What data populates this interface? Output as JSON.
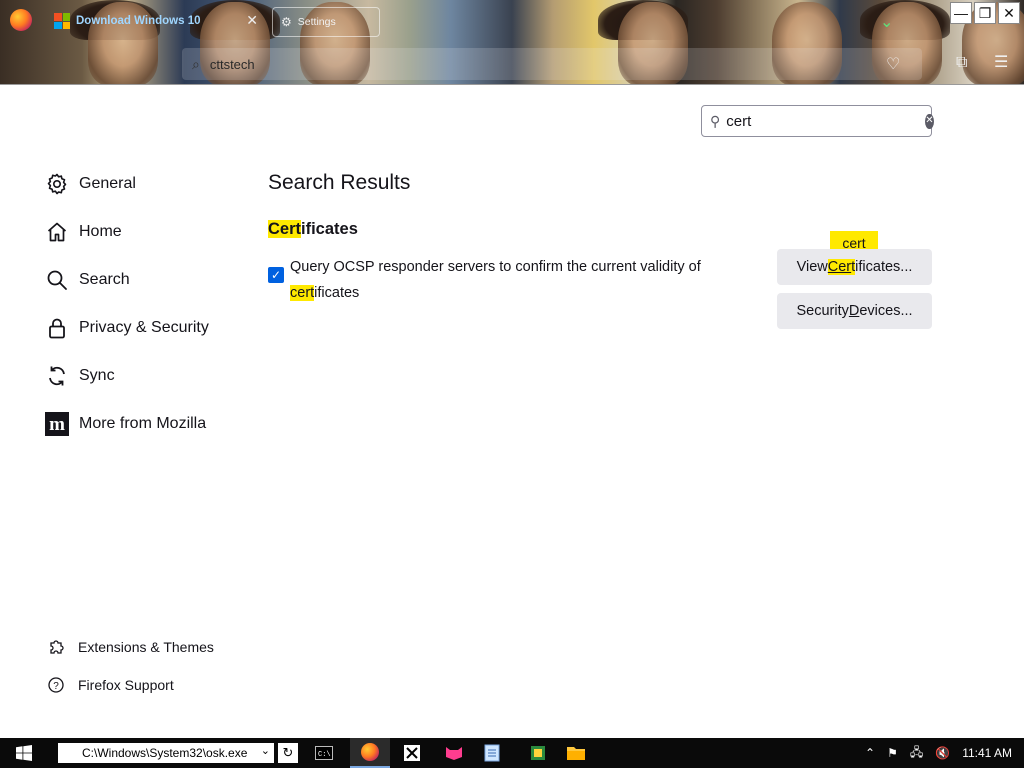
{
  "browser": {
    "tab_title": "Download Windows 10",
    "tab2_label": "Settings",
    "url_text": "cttstech",
    "window_controls": [
      "minimize-icon",
      "restore-icon",
      "close-icon"
    ]
  },
  "search": {
    "value": "cert",
    "clear_icon": "clear-icon"
  },
  "nav": {
    "items": [
      {
        "label": "General",
        "icon": "gear-icon"
      },
      {
        "label": "Home",
        "icon": "home-icon"
      },
      {
        "label": "Search",
        "icon": "search-icon"
      },
      {
        "label": "Privacy & Security",
        "icon": "lock-icon"
      },
      {
        "label": "Sync",
        "icon": "sync-icon"
      },
      {
        "label": "More from Mozilla",
        "icon": "mozilla-icon"
      }
    ],
    "bottom": [
      {
        "label": "Extensions & Themes",
        "icon": "puzzle-icon"
      },
      {
        "label": "Firefox Support",
        "icon": "help-icon"
      }
    ]
  },
  "main": {
    "results_title": "Search Results",
    "section_title_hl": "Cert",
    "section_title_rest": "ificates",
    "checkbox_checked": true,
    "checkbox_text_pre": "Query OCSP responder servers to confirm the current validity of ",
    "checkbox_text_hl": "cert",
    "checkbox_text_post": "ificates",
    "view_certs_pre": "View ",
    "view_certs_hl": "Cer",
    "view_certs_hl2": "t",
    "view_certs_post": "ificates...",
    "security_devices_pre": "Security ",
    "security_devices_u": "D",
    "security_devices_post": "evices...",
    "tooltip": "cert"
  },
  "taskbar": {
    "run_path": "C:\\Windows\\System32\\osk.exe",
    "clock": "11:41 AM"
  },
  "colors": {
    "highlight": "#ffe900",
    "accent": "#0061e0",
    "button_bg": "#e9e9ed"
  }
}
